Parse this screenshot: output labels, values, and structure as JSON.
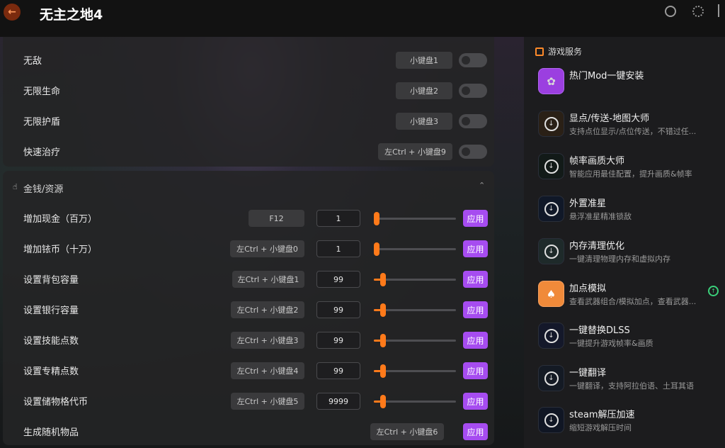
{
  "app": {
    "title": "无主之地4"
  },
  "colors": {
    "accent": "#a64cf0",
    "slider": "#ff7a1a",
    "update": "#3ad07a"
  },
  "top_items": [
    {
      "label": "无敌",
      "hotkey": "小键盘1",
      "enabled": false
    },
    {
      "label": "无限生命",
      "hotkey": "小键盘2",
      "enabled": false
    },
    {
      "label": "无限护盾",
      "hotkey": "小键盘3",
      "enabled": false
    },
    {
      "label": "快速治疗",
      "hotkey": "左Ctrl + 小键盘9",
      "enabled": false
    }
  ],
  "money_section": {
    "title": "金钱/资源",
    "apply_label": "应用",
    "items": [
      {
        "label": "增加现金（百万）",
        "hotkey": "F12",
        "value": "1",
        "slider_fraction": 0.0
      },
      {
        "label": "增加铱币（十万）",
        "hotkey": "左Ctrl + 小键盘0",
        "value": "1",
        "slider_fraction": 0.0
      },
      {
        "label": "设置背包容量",
        "hotkey": "左Ctrl + 小键盘1",
        "value": "99",
        "slider_fraction": 0.08
      },
      {
        "label": "设置银行容量",
        "hotkey": "左Ctrl + 小键盘2",
        "value": "99",
        "slider_fraction": 0.08
      },
      {
        "label": "设置技能点数",
        "hotkey": "左Ctrl + 小键盘3",
        "value": "99",
        "slider_fraction": 0.08
      },
      {
        "label": "设置专精点数",
        "hotkey": "左Ctrl + 小键盘4",
        "value": "99",
        "slider_fraction": 0.08
      },
      {
        "label": "设置储物格代币",
        "hotkey": "左Ctrl + 小键盘5",
        "value": "9999",
        "slider_fraction": 0.08
      }
    ],
    "random_item": {
      "label": "生成随机物品",
      "hotkey": "左Ctrl + 小键盘6"
    }
  },
  "sidebar": {
    "title": "游戏服务",
    "items": [
      {
        "title": "热门Mod一键安装",
        "desc": "",
        "icon": "mod-icon"
      },
      {
        "title": "显点/传送-地图大师",
        "desc": "支持点位显示/点位传送，不错过任...",
        "icon": "download-icon"
      },
      {
        "title": "帧率画质大师",
        "desc": "智能应用最佳配置，提升画质&帧率",
        "icon": "download-icon"
      },
      {
        "title": "外置准星",
        "desc": "悬浮准星精准锁敌",
        "icon": "download-icon"
      },
      {
        "title": "内存清理优化",
        "desc": "一键清理物理内存和虚拟内存",
        "icon": "download-icon"
      },
      {
        "title": "加点模拟",
        "desc": "查看武器组合/模拟加点，查看武器...",
        "icon": "card-icon"
      },
      {
        "title": "一键替换DLSS",
        "desc": "一键提升游戏帧率&画质",
        "icon": "download-icon"
      },
      {
        "title": "一键翻译",
        "desc": "一键翻译，支持阿拉伯语、土耳其语",
        "icon": "download-icon"
      },
      {
        "title": "steam解压加速",
        "desc": "缩短游戏解压时间",
        "icon": "download-icon"
      }
    ]
  }
}
